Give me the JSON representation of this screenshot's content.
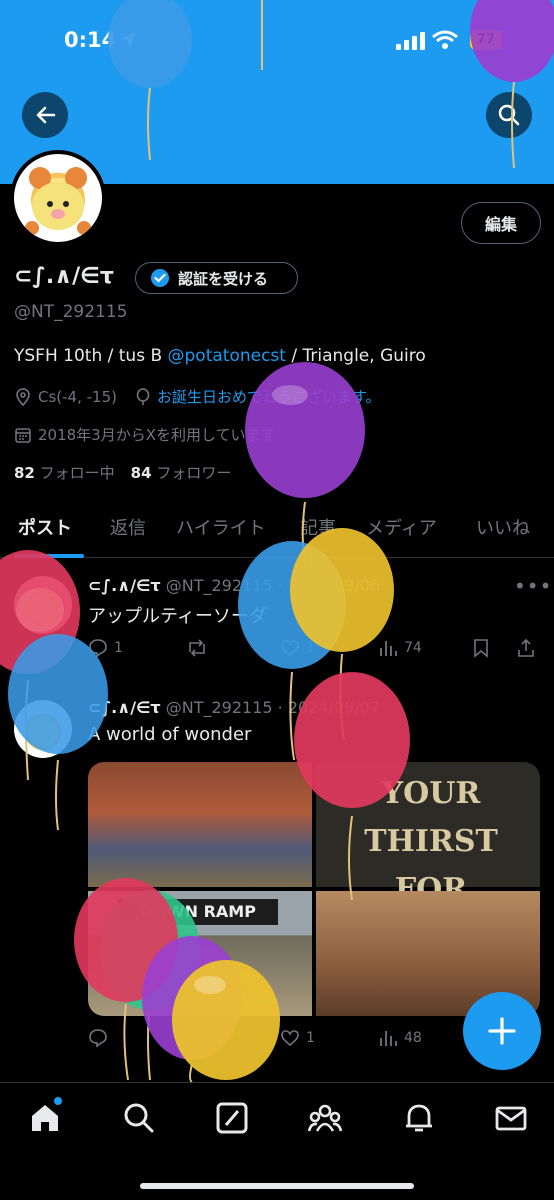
{
  "status_bar": {
    "time": "0:14",
    "battery": "77"
  },
  "profile": {
    "display_name": "⊂∫.∧/∈τ",
    "verify_label": "認証を受ける",
    "handle": "@NT_292115",
    "edit_label": "編集",
    "bio_prefix": "YSFH 10th / tus B ",
    "bio_link": "@potatonecst",
    "bio_suffix": " / Triangle, Guiro",
    "location": "Cs(-4, -15)",
    "birthday": "お誕生日おめでとうございます。",
    "joined": "2018年3月からXを利用しています",
    "following_count": "82",
    "following_label": "フォロー中",
    "followers_count": "84",
    "followers_label": "フォロワー"
  },
  "tabs": [
    "ポスト",
    "返信",
    "ハイライト",
    "記事",
    "メディア",
    "いいね"
  ],
  "tweets": [
    {
      "name": "⊂∫.∧/∈τ",
      "handle_date": "@NT_292115 · 2024/09/06",
      "text": "アップルティーソーダ",
      "replies": "1",
      "likes": "1",
      "views": "74"
    },
    {
      "name": "⊂∫.∧/∈τ",
      "handle_date": "@NT_292115 · 2024/09/07",
      "text": "A world of wonder",
      "likes": "1",
      "views": "48",
      "media_text": {
        "sign": "YOUR THIRST FOR",
        "ramp": "DOWN RAMP"
      }
    }
  ],
  "colors": {
    "accent": "#1d9bf0",
    "background": "#000000",
    "muted": "#71767b"
  }
}
